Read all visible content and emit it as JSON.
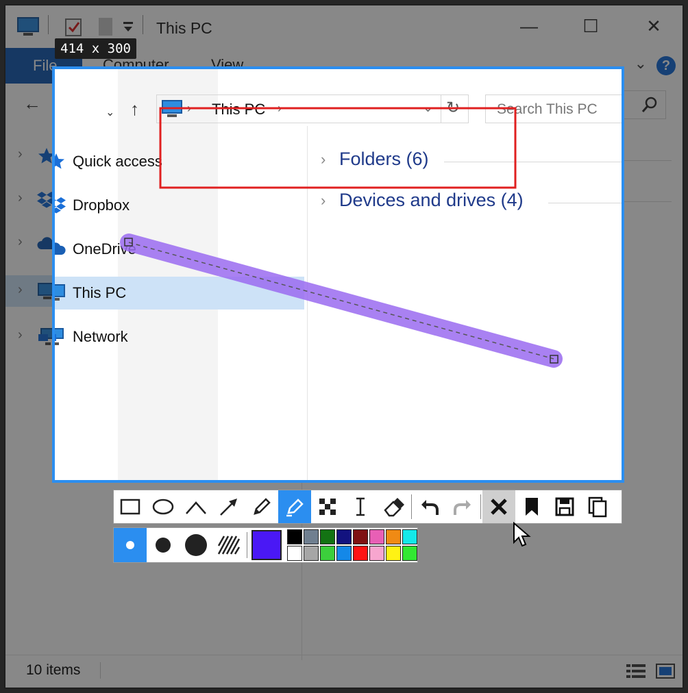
{
  "window": {
    "title": "This PC",
    "controls": {
      "minimize": "—",
      "maximize": "☐",
      "close": "✕"
    }
  },
  "ribbon": {
    "tabs": [
      "File",
      "Computer",
      "View"
    ],
    "help": "?"
  },
  "address": {
    "location": "This PC"
  },
  "search": {
    "placeholder": "Search This PC"
  },
  "sidebar": {
    "items": [
      {
        "label": "Quick access",
        "icon": "star-icon"
      },
      {
        "label": "Dropbox",
        "icon": "dropbox-icon"
      },
      {
        "label": "OneDrive",
        "icon": "cloud-icon"
      },
      {
        "label": "This PC",
        "icon": "computer-icon",
        "selected": true
      },
      {
        "label": "Network",
        "icon": "network-icon"
      }
    ]
  },
  "groups": [
    {
      "label": "Folders (6)"
    },
    {
      "label": "Devices and drives (4)"
    }
  ],
  "status": {
    "count": "10 items"
  },
  "capture": {
    "size_label": "414 x 300",
    "colors": {
      "frame": "#2b8ef0",
      "rect": "#e02020",
      "highlighter": "#9a6bf0"
    }
  },
  "toolbar": {
    "tools": [
      "rectangle-tool",
      "ellipse-tool",
      "polyline-tool",
      "arrow-tool",
      "pencil-tool",
      "highlighter-tool",
      "mosaic-tool",
      "text-tool",
      "eraser-tool",
      "undo",
      "redo",
      "cancel",
      "pin",
      "save",
      "copy"
    ],
    "active_tool": "highlighter-tool",
    "sizes": [
      "small",
      "medium",
      "large",
      "hatched"
    ],
    "current_color": "#4a18f5",
    "palette": [
      "#000000",
      "#6f7f90",
      "#137313",
      "#12127f",
      "#7f1313",
      "#e85fb5",
      "#f08a14",
      "#14e8e8",
      "#ffffff",
      "#a6a6a6",
      "#3ccf3c",
      "#1488e8",
      "#ff1414",
      "#f7a6cf",
      "#fff214",
      "#32e832"
    ]
  }
}
